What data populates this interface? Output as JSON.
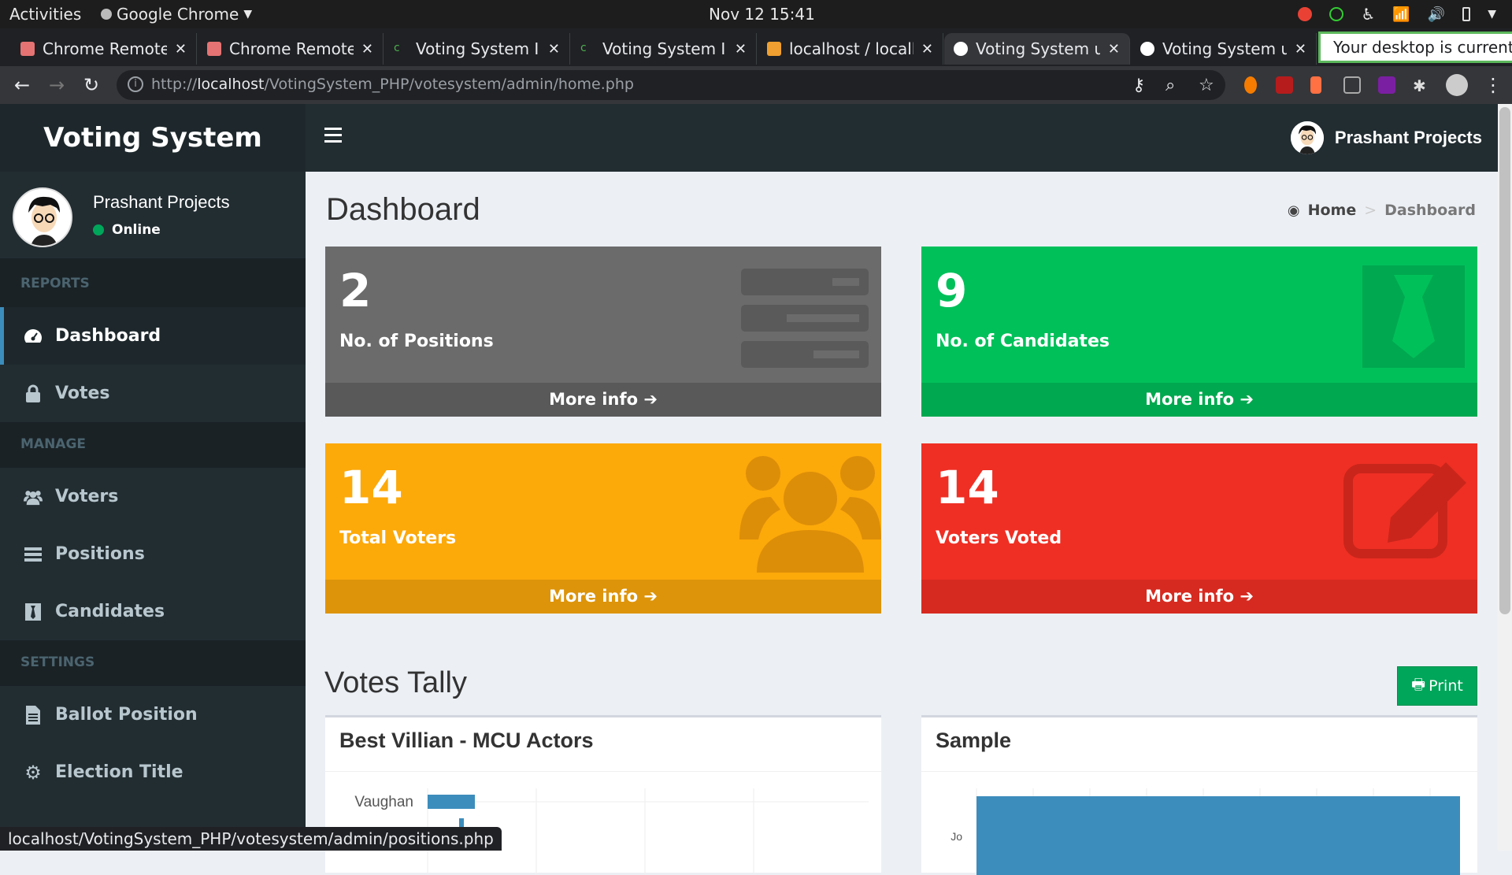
{
  "os": {
    "activities": "Activities",
    "app_name": "Google Chrome",
    "clock": "Nov 12  15:41"
  },
  "tabs": [
    {
      "label": "Chrome Remote",
      "active": false
    },
    {
      "label": "Chrome Remote",
      "active": false
    },
    {
      "label": "Voting System In",
      "active": false
    },
    {
      "label": "Voting System In",
      "active": false
    },
    {
      "label": "localhost / localh",
      "active": false
    },
    {
      "label": "Voting System u",
      "active": true
    },
    {
      "label": "Voting System u",
      "active": false
    }
  ],
  "notice": "Your desktop is currently",
  "address": {
    "prefix": "http://",
    "host": "localhost",
    "path": "/VotingSystem_PHP/votesystem/admin/home.php"
  },
  "status_url": "localhost/VotingSystem_PHP/votesystem/admin/positions.php",
  "sidebar": {
    "brand": "Voting System",
    "user_name": "Prashant Projects",
    "user_status": "Online",
    "sections": [
      {
        "heading": "REPORTS",
        "items": [
          {
            "label": "Dashboard",
            "icon": "dashboard-icon"
          },
          {
            "label": "Votes",
            "icon": "lock-icon"
          }
        ]
      },
      {
        "heading": "MANAGE",
        "items": [
          {
            "label": "Voters",
            "icon": "users-icon"
          },
          {
            "label": "Positions",
            "icon": "tasks-icon"
          },
          {
            "label": "Candidates",
            "icon": "black-tie-icon"
          }
        ]
      },
      {
        "heading": "SETTINGS",
        "items": [
          {
            "label": "Ballot Position",
            "icon": "file-text-icon"
          },
          {
            "label": "Election Title",
            "icon": "cog-icon"
          }
        ]
      }
    ]
  },
  "header": {
    "user_name": "Prashant Projects"
  },
  "page": {
    "title": "Dashboard",
    "breadcrumb_home": "Home",
    "breadcrumb_current": "Dashboard"
  },
  "stats": [
    {
      "value": "2",
      "label": "No. of Positions",
      "more": "More info",
      "color": "#6b6b6b"
    },
    {
      "value": "9",
      "label": "No. of Candidates",
      "more": "More info",
      "color": "#00c05a"
    },
    {
      "value": "14",
      "label": "Total Voters",
      "more": "More info",
      "color": "#fca90a"
    },
    {
      "value": "14",
      "label": "Voters Voted",
      "more": "More info",
      "color": "#ef2f24"
    }
  ],
  "tally": {
    "title": "Votes Tally",
    "print_label": "Print",
    "panels": [
      {
        "title": "Best Villian - MCU Actors",
        "first_bar_label": "Vaughan"
      },
      {
        "title": "Sample",
        "first_bar_label": "Jo"
      }
    ]
  }
}
